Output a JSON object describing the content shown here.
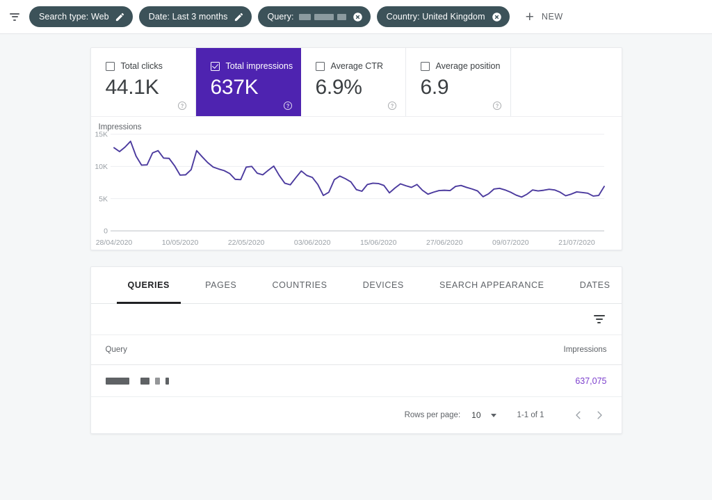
{
  "filter_bar": {
    "filter_icon": "filter-list-icon",
    "chips": [
      {
        "label": "Search type: Web",
        "action_icon": "pencil-icon",
        "redacted": false
      },
      {
        "label": "Date: Last 3 months",
        "action_icon": "pencil-icon",
        "redacted": false
      },
      {
        "label": "Query:",
        "action_icon": "clear-icon",
        "redacted": true,
        "redaction_widths": [
          17,
          28,
          13
        ]
      },
      {
        "label": "Country: United Kingdom",
        "action_icon": "clear-icon",
        "redacted": false
      }
    ],
    "new_button": {
      "icon": "plus-icon",
      "label": "NEW"
    }
  },
  "metrics": [
    {
      "label": "Total clicks",
      "value": "44.1K",
      "checked": false,
      "help_icon": "help-circle-icon"
    },
    {
      "label": "Total impressions",
      "value": "637K",
      "checked": true,
      "help_icon": "help-circle-icon"
    },
    {
      "label": "Average CTR",
      "value": "6.9%",
      "checked": false,
      "help_icon": "help-circle-icon"
    },
    {
      "label": "Average position",
      "value": "6.9",
      "checked": false,
      "help_icon": "help-circle-icon"
    }
  ],
  "chart_data": {
    "type": "line",
    "title": "Impressions",
    "xlabel": "",
    "ylabel": "Impressions",
    "ylim": [
      0,
      15000
    ],
    "yticks": [
      0,
      5000,
      10000,
      15000
    ],
    "ytick_labels": [
      "0",
      "5K",
      "10K",
      "15K"
    ],
    "grid": true,
    "legend": false,
    "line_color": "#4b3a9e",
    "xtick_labels": [
      "28/04/2020",
      "10/05/2020",
      "22/05/2020",
      "03/06/2020",
      "15/06/2020",
      "27/06/2020",
      "09/07/2020",
      "21/07/2020"
    ],
    "xtick_indices": [
      0,
      12,
      24,
      36,
      48,
      60,
      72,
      84
    ],
    "series": [
      {
        "name": "Impressions",
        "values": [
          12900,
          12300,
          13000,
          13900,
          11600,
          10200,
          10250,
          12100,
          12450,
          11300,
          11250,
          10100,
          8650,
          8700,
          9500,
          12450,
          11500,
          10600,
          9900,
          9600,
          9350,
          8900,
          8000,
          7950,
          9900,
          10000,
          8950,
          8700,
          9400,
          10050,
          8600,
          7400,
          7150,
          8250,
          9300,
          8600,
          8300,
          7200,
          5500,
          6000,
          7950,
          8500,
          8100,
          7600,
          6400,
          6150,
          7200,
          7400,
          7350,
          7050,
          5900,
          6650,
          7300,
          7000,
          6750,
          7200,
          6300,
          5700,
          6000,
          6250,
          6300,
          6250,
          6900,
          7050,
          6750,
          6500,
          6200,
          5300,
          5750,
          6500,
          6600,
          6350,
          6000,
          5550,
          5250,
          5700,
          6350,
          6200,
          6300,
          6450,
          6350,
          6000,
          5450,
          5700,
          6050,
          5950,
          5850,
          5400,
          5500,
          6900
        ]
      }
    ]
  },
  "table": {
    "tabs": [
      {
        "label": "QUERIES",
        "active": true
      },
      {
        "label": "PAGES",
        "active": false
      },
      {
        "label": "COUNTRIES",
        "active": false
      },
      {
        "label": "DEVICES",
        "active": false
      },
      {
        "label": "SEARCH APPEARANCE",
        "active": false
      },
      {
        "label": "DATES",
        "active": false
      }
    ],
    "toolbar_filter_icon": "filter-list-icon",
    "columns": [
      "Query",
      "Impressions"
    ],
    "rows": [
      {
        "query_redacted": true,
        "query_redaction_widths": [
          34,
          13,
          7,
          5
        ],
        "impressions": "637,075"
      }
    ],
    "pagination": {
      "rows_per_page_label": "Rows per page:",
      "rows_per_page_value": "10",
      "range_label": "1-1 of 1",
      "prev_icon": "chevron-left-icon",
      "next_icon": "chevron-right-icon"
    }
  },
  "colors": {
    "accent_purple": "#4e23b0",
    "chip_bg": "#3c5259",
    "line": "#4b3a9e",
    "link_purple": "#7c3fcd",
    "page_bg": "#f5f7f8"
  }
}
